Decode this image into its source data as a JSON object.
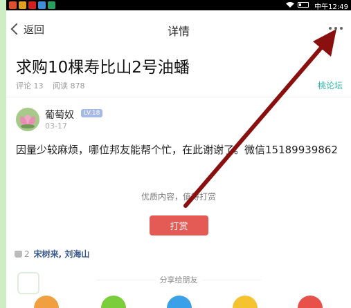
{
  "status_bar": {
    "time": "中午12:49",
    "app_icons": [
      "#e05030",
      "#e0a020",
      "#d02020",
      "#3f90d8",
      "#28a060"
    ]
  },
  "nav": {
    "back_label": "返回",
    "title": "详情"
  },
  "post": {
    "title": "求购10棵寿比山2号油蟠",
    "comments": "评论 13",
    "reads": "阅读 878",
    "forum_link": "桃论坛"
  },
  "author": {
    "name": "葡萄奴",
    "level": "LV.18",
    "date": "03-17"
  },
  "content": "因量少较麻烦，哪位邦友能帮个忙，在此谢谢了。微信15189939862",
  "tip": {
    "text": "优质内容，值得打赏",
    "button_label": "打赏"
  },
  "likes": {
    "count": "2",
    "names": "宋树来, 刘海山"
  },
  "share": {
    "label": "分享给朋友",
    "colors": [
      "#f0a040",
      "#7ccd3c",
      "#3aa0e8",
      "#f5c330",
      "#e8504a"
    ]
  },
  "annotation": {
    "arrow_color": "#8a1010"
  }
}
